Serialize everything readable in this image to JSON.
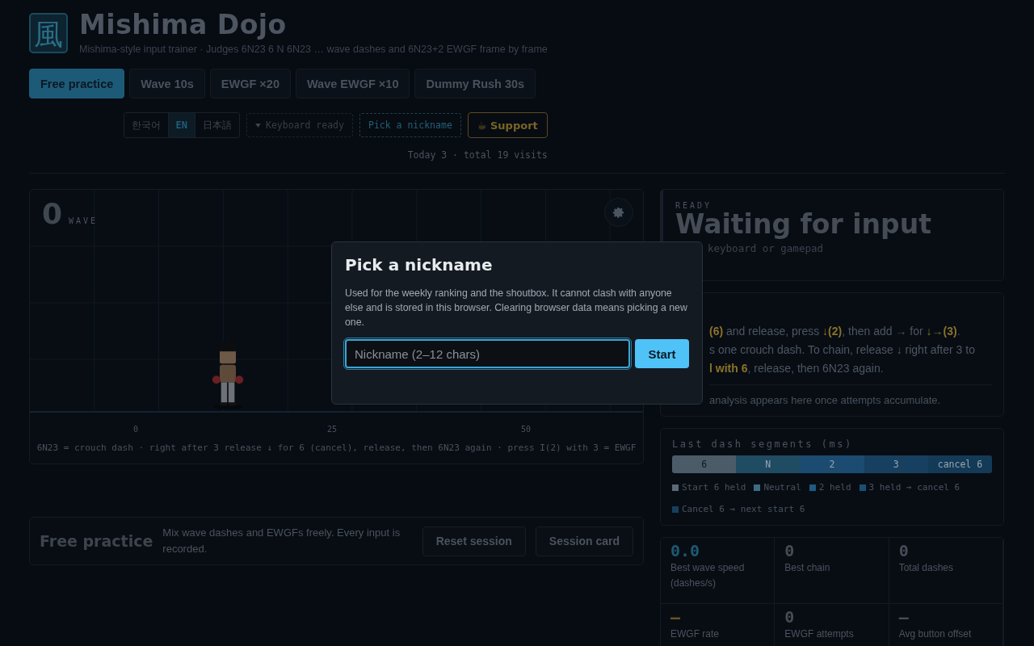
{
  "header": {
    "logo": "風",
    "title": "Mishima Dojo",
    "subtitle": "Mishima-style input trainer · Judges 6N23 6 N 6N23 … wave dashes and 6N23+2 EWGF frame by frame"
  },
  "modes": [
    {
      "label": "Free practice",
      "selected": true
    },
    {
      "label": "Wave 10s",
      "selected": false
    },
    {
      "label": "EWGF ×20",
      "selected": false
    },
    {
      "label": "Wave EWGF ×10",
      "selected": false
    },
    {
      "label": "Dummy Rush 30s",
      "selected": false
    }
  ],
  "languages": [
    {
      "label": "한국어",
      "selected": false
    },
    {
      "label": "EN",
      "selected": true
    },
    {
      "label": "日本語",
      "selected": false
    }
  ],
  "keyboard_status": "Keyboard ready",
  "nickname_button": "Pick a nickname",
  "support_button": "☕ Support",
  "visits": "Today 3 · total 19 visits",
  "stage": {
    "count": "0",
    "count_label": "WAVE",
    "axis_labels": [
      "0",
      "25",
      "50"
    ],
    "caption": "6N23 = crouch dash · right after 3 release ↓ for 6 (cancel), release, then 6N23 again · press I(2) with 3 = EWGF"
  },
  "mode_panel": {
    "title": "Free practice",
    "description": "Mix wave dashes and EWGFs freely. Every input is recorded.",
    "buttons": [
      "Reset session",
      "Session card"
    ]
  },
  "status_card": {
    "label": "READY",
    "title": "Waiting for input",
    "hint": "keyboard or gamepad"
  },
  "guide_card": {
    "lines": [
      "**(6)** and release, press **↓(2)**, then add → for **↓→(3)**.",
      "s one crouch dash. To chain, release ↓ right after 3 to",
      "**l with 6**, release, then 6N23 again."
    ],
    "note": "analysis appears here once attempts accumulate."
  },
  "segments_card": {
    "title": "Last dash segments (ms)",
    "segments": [
      {
        "label": "6",
        "color": "#4b5c68"
      },
      {
        "label": "N",
        "color": "#1f4b63"
      },
      {
        "label": "2",
        "color": "#1b4b70"
      },
      {
        "label": "3",
        "color": "#173f5f"
      },
      {
        "label": "cancel 6",
        "color": "#133a57"
      }
    ],
    "legend": [
      {
        "label": "Start 6 held",
        "color": "#5a6a76"
      },
      {
        "label": "Neutral",
        "color": "#3e6b82"
      },
      {
        "label": "2 held",
        "color": "#1f5a82"
      },
      {
        "label": "3 held → cancel 6",
        "color": "#1c4e72"
      },
      {
        "label": "Cancel 6 → next start 6",
        "color": "#163f5c"
      }
    ]
  },
  "stats": [
    {
      "value": "0.0",
      "label": "Best wave speed (dashes/s)",
      "kind": "accent"
    },
    {
      "value": "0",
      "label": "Best chain",
      "kind": "plain"
    },
    {
      "value": "0",
      "label": "Total dashes",
      "kind": "plain"
    },
    {
      "value": "–",
      "label": "EWGF rate",
      "kind": "warn"
    },
    {
      "value": "0",
      "label": "EWGF attempts",
      "kind": "plain"
    },
    {
      "value": "–",
      "label": "Avg button offset",
      "kind": "plain"
    }
  ],
  "dialog": {
    "title": "Pick a nickname",
    "text": "Used for the weekly ranking and the shoutbox. It cannot clash with anyone else and is stored in this browser. Clearing browser data means picking a new one.",
    "placeholder": "Nickname (2–12 chars)",
    "button": "Start"
  }
}
